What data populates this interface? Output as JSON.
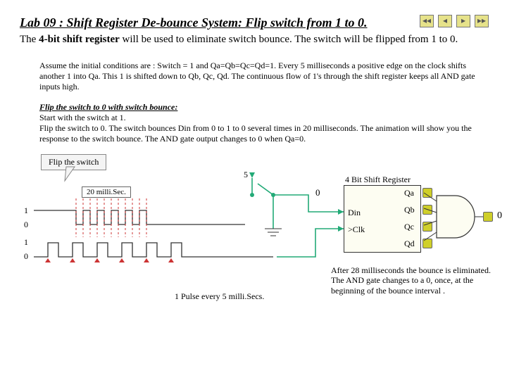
{
  "title_main": "Lab 09 : Shift Register De-bounce System:",
  "title_sub": " Flip switch from 1 to 0.",
  "intro_html_prefix": "The ",
  "intro_bold": "4-bit shift register",
  "intro_rest": " will be used to eliminate switch bounce. The switch will be flipped from 1 to 0.",
  "para1": "Assume the initial conditions are : Switch = 1 and Qa=Qb=Qc=Qd=1. Every 5 milliseconds a positive edge on the clock shifts another 1 into Qa. This 1 is shifted down to Qb, Qc, Qd. The continuous flow of 1's through the shift register keeps all AND gate inputs high.",
  "flip_hdr": "Flip the switch to 0 with switch bounce:",
  "para2": "Start with the switch at 1.\nFlip the switch to 0. The switch bounces Din from 0 to 1 to 0 several times in 20 milliseconds. The animation will show you the response to the switch bounce. The AND gate output changes to 0 when Qa=0.",
  "btn_flip": "Flip the switch",
  "tag_20ms": "20 milli.Sec.",
  "lbl_5v": "5 v",
  "lbl_0": "0",
  "levels_sw": [
    "1",
    "0"
  ],
  "levels_clk": [
    "1",
    "0"
  ],
  "sr": {
    "title": "4 Bit Shift Register",
    "din": "Din",
    "clk": ">Clk",
    "qa": "Qa",
    "qb": "Qb",
    "qc": "Qc",
    "qd": "Qd"
  },
  "and_out": "0",
  "pulse_lbl": "1 Pulse every 5 milli.Secs.",
  "footnote": "After 28 milliseconds the bounce is eliminated. The AND gate changes to a 0, once, at the beginning of the bounce interval ."
}
